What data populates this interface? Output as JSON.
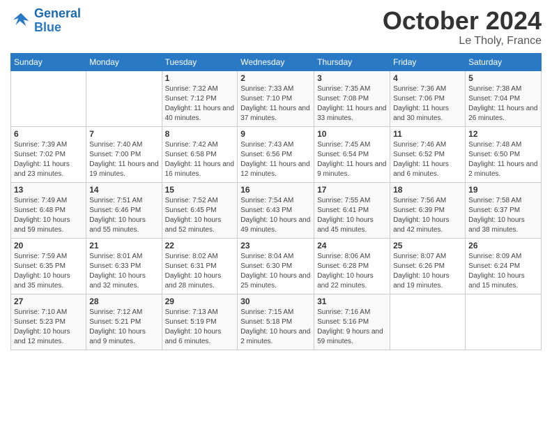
{
  "logo": {
    "line1": "General",
    "line2": "Blue"
  },
  "title": "October 2024",
  "location": "Le Tholy, France",
  "days_header": [
    "Sunday",
    "Monday",
    "Tuesday",
    "Wednesday",
    "Thursday",
    "Friday",
    "Saturday"
  ],
  "weeks": [
    [
      {
        "day": "",
        "info": ""
      },
      {
        "day": "",
        "info": ""
      },
      {
        "day": "1",
        "info": "Sunrise: 7:32 AM\nSunset: 7:12 PM\nDaylight: 11 hours and 40 minutes."
      },
      {
        "day": "2",
        "info": "Sunrise: 7:33 AM\nSunset: 7:10 PM\nDaylight: 11 hours and 37 minutes."
      },
      {
        "day": "3",
        "info": "Sunrise: 7:35 AM\nSunset: 7:08 PM\nDaylight: 11 hours and 33 minutes."
      },
      {
        "day": "4",
        "info": "Sunrise: 7:36 AM\nSunset: 7:06 PM\nDaylight: 11 hours and 30 minutes."
      },
      {
        "day": "5",
        "info": "Sunrise: 7:38 AM\nSunset: 7:04 PM\nDaylight: 11 hours and 26 minutes."
      }
    ],
    [
      {
        "day": "6",
        "info": "Sunrise: 7:39 AM\nSunset: 7:02 PM\nDaylight: 11 hours and 23 minutes."
      },
      {
        "day": "7",
        "info": "Sunrise: 7:40 AM\nSunset: 7:00 PM\nDaylight: 11 hours and 19 minutes."
      },
      {
        "day": "8",
        "info": "Sunrise: 7:42 AM\nSunset: 6:58 PM\nDaylight: 11 hours and 16 minutes."
      },
      {
        "day": "9",
        "info": "Sunrise: 7:43 AM\nSunset: 6:56 PM\nDaylight: 11 hours and 12 minutes."
      },
      {
        "day": "10",
        "info": "Sunrise: 7:45 AM\nSunset: 6:54 PM\nDaylight: 11 hours and 9 minutes."
      },
      {
        "day": "11",
        "info": "Sunrise: 7:46 AM\nSunset: 6:52 PM\nDaylight: 11 hours and 6 minutes."
      },
      {
        "day": "12",
        "info": "Sunrise: 7:48 AM\nSunset: 6:50 PM\nDaylight: 11 hours and 2 minutes."
      }
    ],
    [
      {
        "day": "13",
        "info": "Sunrise: 7:49 AM\nSunset: 6:48 PM\nDaylight: 10 hours and 59 minutes."
      },
      {
        "day": "14",
        "info": "Sunrise: 7:51 AM\nSunset: 6:46 PM\nDaylight: 10 hours and 55 minutes."
      },
      {
        "day": "15",
        "info": "Sunrise: 7:52 AM\nSunset: 6:45 PM\nDaylight: 10 hours and 52 minutes."
      },
      {
        "day": "16",
        "info": "Sunrise: 7:54 AM\nSunset: 6:43 PM\nDaylight: 10 hours and 49 minutes."
      },
      {
        "day": "17",
        "info": "Sunrise: 7:55 AM\nSunset: 6:41 PM\nDaylight: 10 hours and 45 minutes."
      },
      {
        "day": "18",
        "info": "Sunrise: 7:56 AM\nSunset: 6:39 PM\nDaylight: 10 hours and 42 minutes."
      },
      {
        "day": "19",
        "info": "Sunrise: 7:58 AM\nSunset: 6:37 PM\nDaylight: 10 hours and 38 minutes."
      }
    ],
    [
      {
        "day": "20",
        "info": "Sunrise: 7:59 AM\nSunset: 6:35 PM\nDaylight: 10 hours and 35 minutes."
      },
      {
        "day": "21",
        "info": "Sunrise: 8:01 AM\nSunset: 6:33 PM\nDaylight: 10 hours and 32 minutes."
      },
      {
        "day": "22",
        "info": "Sunrise: 8:02 AM\nSunset: 6:31 PM\nDaylight: 10 hours and 28 minutes."
      },
      {
        "day": "23",
        "info": "Sunrise: 8:04 AM\nSunset: 6:30 PM\nDaylight: 10 hours and 25 minutes."
      },
      {
        "day": "24",
        "info": "Sunrise: 8:06 AM\nSunset: 6:28 PM\nDaylight: 10 hours and 22 minutes."
      },
      {
        "day": "25",
        "info": "Sunrise: 8:07 AM\nSunset: 6:26 PM\nDaylight: 10 hours and 19 minutes."
      },
      {
        "day": "26",
        "info": "Sunrise: 8:09 AM\nSunset: 6:24 PM\nDaylight: 10 hours and 15 minutes."
      }
    ],
    [
      {
        "day": "27",
        "info": "Sunrise: 7:10 AM\nSunset: 5:23 PM\nDaylight: 10 hours and 12 minutes."
      },
      {
        "day": "28",
        "info": "Sunrise: 7:12 AM\nSunset: 5:21 PM\nDaylight: 10 hours and 9 minutes."
      },
      {
        "day": "29",
        "info": "Sunrise: 7:13 AM\nSunset: 5:19 PM\nDaylight: 10 hours and 6 minutes."
      },
      {
        "day": "30",
        "info": "Sunrise: 7:15 AM\nSunset: 5:18 PM\nDaylight: 10 hours and 2 minutes."
      },
      {
        "day": "31",
        "info": "Sunrise: 7:16 AM\nSunset: 5:16 PM\nDaylight: 9 hours and 59 minutes."
      },
      {
        "day": "",
        "info": ""
      },
      {
        "day": "",
        "info": ""
      }
    ]
  ]
}
